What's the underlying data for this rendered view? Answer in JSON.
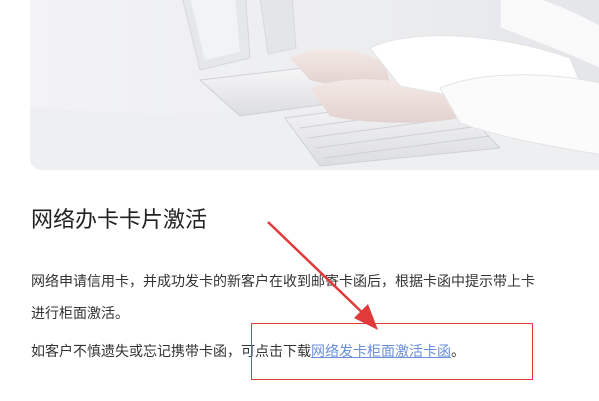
{
  "hero": {
    "image": "office-hands-typing-keyboard-photo"
  },
  "section": {
    "title": "网络办卡卡片激活",
    "paragraph1_line1": "网络申请信用卡，并成功发卡的新客户在收到邮寄卡函后，根据卡函中提示带上卡",
    "paragraph1_line2": "进行柜面激活。",
    "paragraph2_prefix": "如客户不慎遗失或忘记携带卡函，可点击下载",
    "download_link_label": "网络发卡柜面激活卡函",
    "paragraph2_suffix": "。"
  },
  "annotation": {
    "color": "#e03a3a"
  }
}
